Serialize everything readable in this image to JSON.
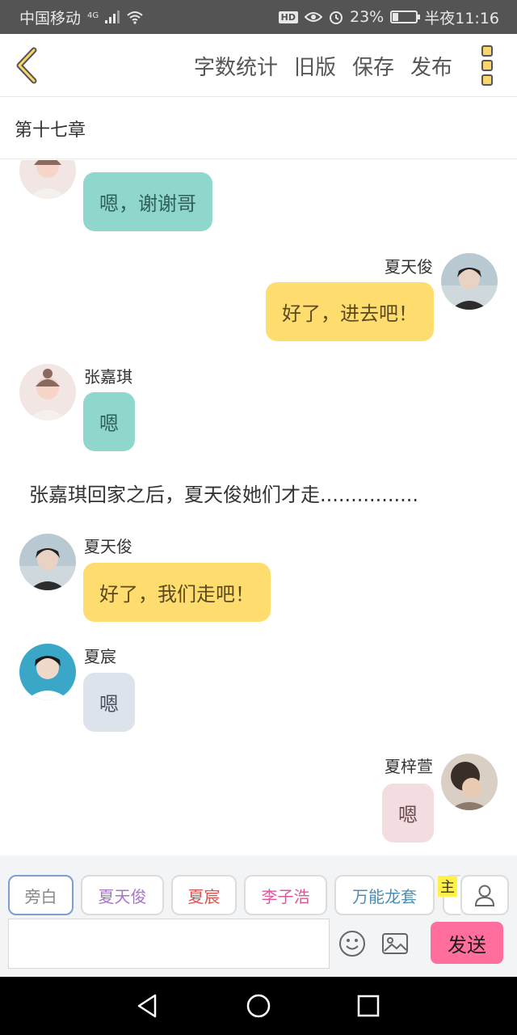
{
  "status_bar": {
    "carrier": "中国移动",
    "network": "4G",
    "battery": "23%",
    "battery_level": 0.23,
    "time": "半夜11:16"
  },
  "toolbar": {
    "back_icon": "chevron-left-icon",
    "actions": [
      "字数统计",
      "旧版",
      "保存",
      "发布"
    ],
    "more_icon": "more-vertical-icon"
  },
  "chapter": {
    "title": "第十七章"
  },
  "messages": [
    {
      "speaker": "",
      "side": "left",
      "text": "嗯，谢谢哥",
      "color": "#8fd7cc"
    },
    {
      "speaker": "夏天俊",
      "side": "right",
      "text": "好了，进去吧！",
      "color": "#ffdc6e"
    },
    {
      "speaker": "张嘉琪",
      "side": "left",
      "text": "嗯",
      "color": "#8fd7cc"
    },
    {
      "narration": "张嘉琪回家之后，夏天俊她们才走................"
    },
    {
      "speaker": "夏天俊",
      "side": "left",
      "text": "好了，我们走吧！",
      "color": "#ffdc6e"
    },
    {
      "speaker": "夏宸",
      "side": "left",
      "text": "嗯",
      "color": "#dde3ea"
    },
    {
      "speaker": "夏梓萱",
      "side": "right",
      "text": "嗯",
      "color": "#f3dde0"
    }
  ],
  "composer": {
    "chips": [
      {
        "label": "旁白",
        "color": "#888888"
      },
      {
        "label": "夏天俊",
        "color": "#a873c9"
      },
      {
        "label": "夏宸",
        "color": "#d9534f"
      },
      {
        "label": "李子浩",
        "color": "#e0559a"
      },
      {
        "label": "万能龙套",
        "color": "#4a8fb3"
      }
    ],
    "main_tag": "主",
    "input_placeholder": "",
    "send_label": "发送"
  },
  "colors": {
    "accent": "#f7d66b",
    "send": "#ff6e9c"
  }
}
